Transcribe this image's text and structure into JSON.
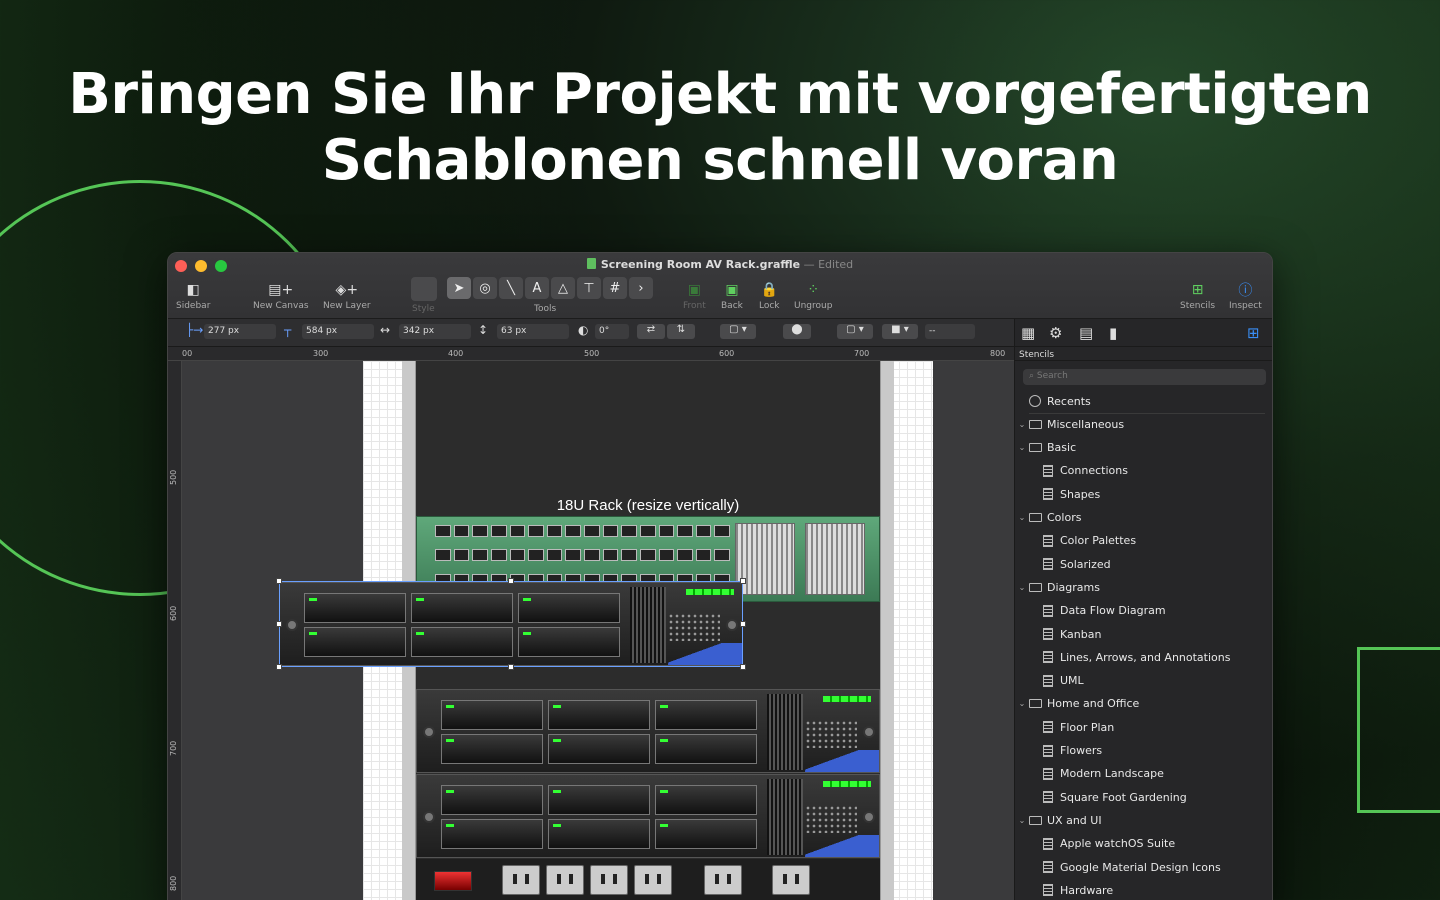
{
  "headline": {
    "line1": "Bringen Sie Ihr Projekt mit vorgefertigten",
    "line2": "Schablonen schnell voran"
  },
  "window": {
    "title": "Screening Room AV Rack.graffle",
    "separator": "—",
    "status": "Edited"
  },
  "toolbar": {
    "sidebar": "Sidebar",
    "new_canvas": "New Canvas",
    "new_layer": "New Layer",
    "style": "Style",
    "tools": "Tools",
    "front": "Front",
    "back": "Back",
    "lock": "Lock",
    "ungroup": "Ungroup",
    "stencils": "Stencils",
    "inspect": "Inspect"
  },
  "inspector_bar": {
    "x": "277 px",
    "y": "584 px",
    "width": "342 px",
    "height": "63 px",
    "rotation": "0°",
    "dash": "--"
  },
  "rulers": {
    "horizontal": [
      "00",
      "300",
      "400",
      "500",
      "600",
      "700",
      "800"
    ],
    "vertical": [
      "500",
      "600",
      "700",
      "800"
    ]
  },
  "canvas": {
    "rack_label": "18U Rack (resize vertically)"
  },
  "sidebar": {
    "header": "Stencils",
    "search_placeholder": "Search",
    "items": [
      {
        "label": "Recents",
        "kind": "recent"
      },
      {
        "label": "Miscellaneous",
        "kind": "folder"
      },
      {
        "label": "Basic",
        "kind": "folder"
      },
      {
        "label": "Connections",
        "kind": "stencil"
      },
      {
        "label": "Shapes",
        "kind": "stencil"
      },
      {
        "label": "Colors",
        "kind": "folder"
      },
      {
        "label": "Color Palettes",
        "kind": "stencil"
      },
      {
        "label": "Solarized",
        "kind": "stencil"
      },
      {
        "label": "Diagrams",
        "kind": "folder"
      },
      {
        "label": "Data Flow Diagram",
        "kind": "stencil"
      },
      {
        "label": "Kanban",
        "kind": "stencil"
      },
      {
        "label": "Lines, Arrows, and Annotations",
        "kind": "stencil"
      },
      {
        "label": "UML",
        "kind": "stencil"
      },
      {
        "label": "Home and Office",
        "kind": "folder"
      },
      {
        "label": "Floor Plan",
        "kind": "stencil"
      },
      {
        "label": "Flowers",
        "kind": "stencil"
      },
      {
        "label": "Modern Landscape",
        "kind": "stencil"
      },
      {
        "label": "Square Foot Gardening",
        "kind": "stencil"
      },
      {
        "label": "UX and UI",
        "kind": "folder"
      },
      {
        "label": "Apple watchOS Suite",
        "kind": "stencil"
      },
      {
        "label": "Google Material Design Icons",
        "kind": "stencil"
      },
      {
        "label": "Hardware",
        "kind": "stencil"
      }
    ]
  },
  "colors": {
    "accent_green": "#55c556",
    "selection_blue": "#6aa0ff"
  }
}
